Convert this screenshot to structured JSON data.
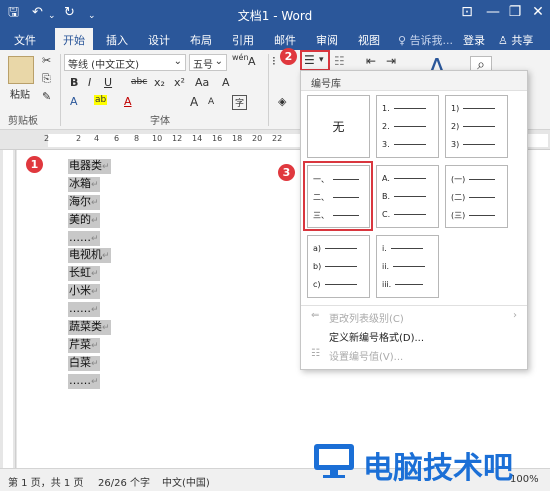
{
  "window": {
    "title": "文档1 - Word",
    "qat": {
      "save": "🖫",
      "undo": "↶",
      "redo": "↻",
      "more": "⌄"
    },
    "controls": {
      "ribbon_opts": "⊡",
      "minimize": "—",
      "restore": "❐",
      "close": "✕"
    }
  },
  "tabs": [
    {
      "label": "文件"
    },
    {
      "label": "开始"
    },
    {
      "label": "插入"
    },
    {
      "label": "设计"
    },
    {
      "label": "布局"
    },
    {
      "label": "引用"
    },
    {
      "label": "邮件"
    },
    {
      "label": "审阅"
    },
    {
      "label": "视图"
    }
  ],
  "tell_me": "告诉我...",
  "signin": "登录",
  "share": "共享",
  "ribbon": {
    "paste_label": "粘贴",
    "clipboard_label": "剪贴板",
    "font_group_label": "字体",
    "font_name": "等线 (中文正文)",
    "font_size": "五号",
    "font_size_arrow": "⌄",
    "wen": "wén",
    "bold": "B",
    "italic": "I",
    "underline": "U",
    "strike": "abc",
    "subscript": "x₂",
    "superscript": "x²",
    "grow": "A",
    "shrink": "A",
    "text_effects": "A",
    "highlight": "ab",
    "font_color": "A",
    "change_case": "Aa",
    "clear_fmt": "A",
    "char_border": "A",
    "styles_glyph": "A",
    "search_glyph": "⌕",
    "para_glyph": "¶"
  },
  "numbering_library": {
    "header": "编号库",
    "none_label": "无",
    "styles": [
      [
        "1.",
        "2.",
        "3."
      ],
      [
        "1)",
        "2)",
        "3)"
      ],
      [
        "一、",
        "二、",
        "三、"
      ],
      [
        "A.",
        "B.",
        "C."
      ],
      [
        "(一)",
        "(二)",
        "(三)"
      ],
      [
        "a)",
        "b)",
        "c)"
      ],
      [
        "i.",
        "ii.",
        "iii."
      ]
    ],
    "menu": {
      "change_level": "更改列表级别(C)",
      "define_new": "定义新编号格式(D)...",
      "set_value": "设置编号值(V)..."
    }
  },
  "document_lines": [
    "电器类",
    "冰箱",
    "海尔",
    "美的",
    "……",
    "电视机",
    "长虹",
    "小米",
    "……",
    "蔬菜类",
    "芹菜",
    "白菜",
    "……"
  ],
  "para_mark": "↵",
  "ruler_numbers": [
    "2",
    "2",
    "4",
    "6",
    "8",
    "10",
    "12",
    "14",
    "16",
    "18",
    "20",
    "22"
  ],
  "statusbar": {
    "page": "第 1 页，共 1 页",
    "words": "26/26 个字",
    "lang": "中文(中国)",
    "zoom": "100%"
  },
  "callouts": [
    "1",
    "2",
    "3"
  ],
  "watermark_text": "电脑技术吧",
  "colors": {
    "accent": "#2b579a",
    "callout": "#e0383e",
    "highlight_box": "#d9363e",
    "watermark": "#1b6fd6"
  }
}
